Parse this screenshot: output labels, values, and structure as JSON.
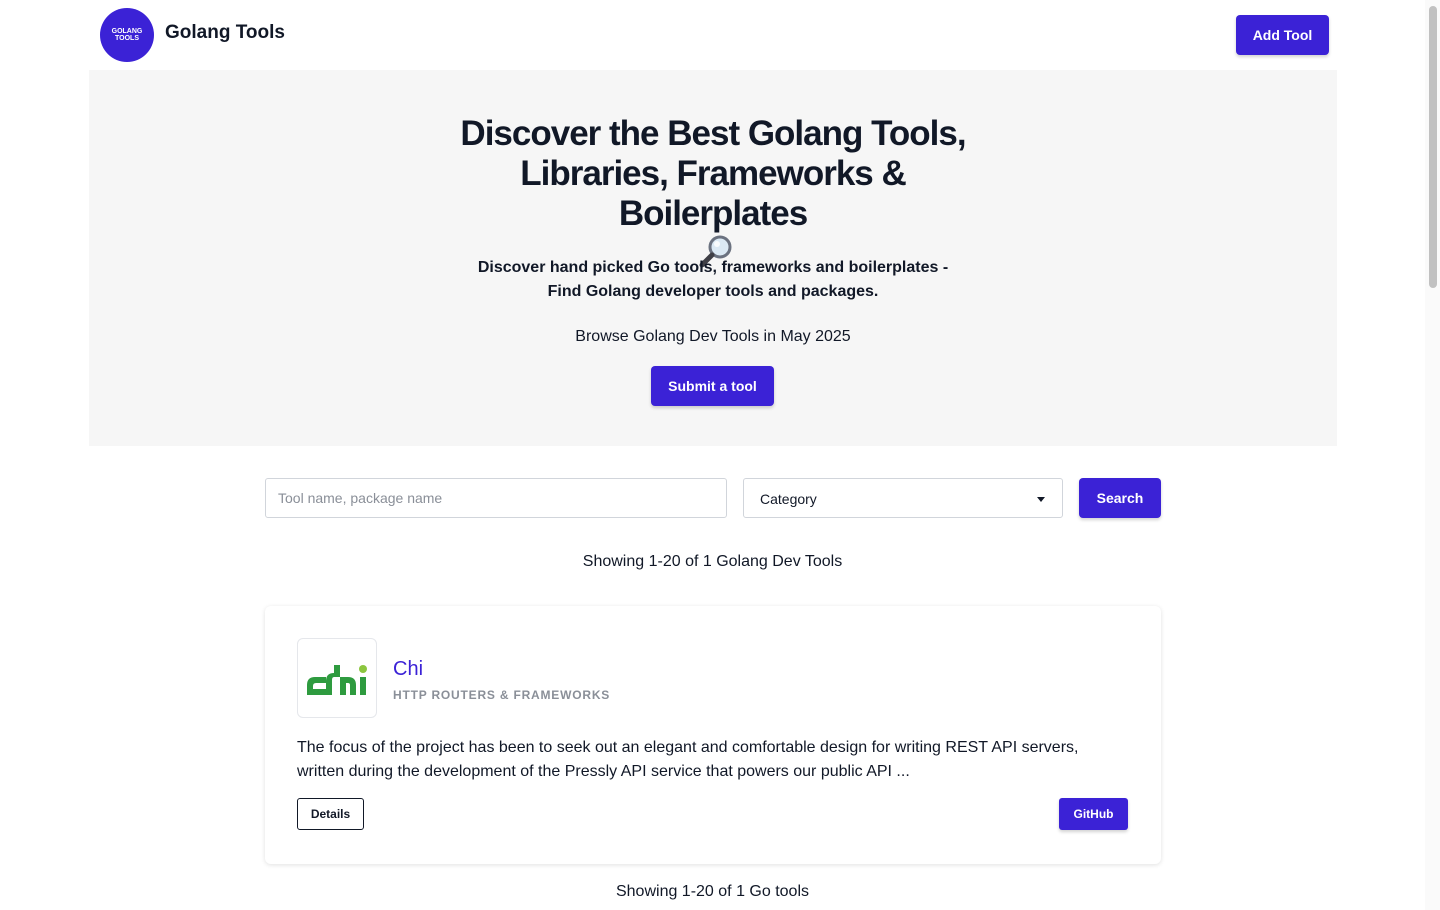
{
  "header": {
    "logo_text_line1": "GOLANG",
    "logo_text_line2": "TOOLS",
    "brand": "Golang Tools",
    "add_tool_label": "Add Tool"
  },
  "hero": {
    "title_lines": [
      "Discover the Best Golang Tools,",
      "Libraries, Frameworks &",
      "Boilerplates"
    ],
    "title_icon": "magnifying-glass-icon",
    "subtitle_lines": [
      "Discover hand picked Go tools, frameworks and boilerplates -",
      "Find Golang developer tools and packages."
    ],
    "browse_text": "Browse Golang Dev Tools in May 2025",
    "submit_label": "Submit a tool"
  },
  "search": {
    "placeholder": "Tool name, package name",
    "value": "",
    "category_label": "Category",
    "search_label": "Search"
  },
  "results": {
    "count_text": "Showing 1-20 of 1 Golang Dev Tools",
    "footer_text": "Showing 1-20 of 1 Go tools"
  },
  "tools": [
    {
      "name": "Chi",
      "logo_text": "chi",
      "category": "HTTP ROUTERS & FRAMEWORKS",
      "description": "The focus of the project has been to seek out an elegant and comfortable design for writing REST API servers, written during the development of the Pressly API service that powers our public API ...",
      "details_label": "Details",
      "github_label": "GitHub"
    }
  ],
  "colors": {
    "accent": "#3b22d6",
    "hero_bg": "#f6f6f6",
    "chi_green": "#2e9b3f",
    "muted": "#8a8f98"
  }
}
